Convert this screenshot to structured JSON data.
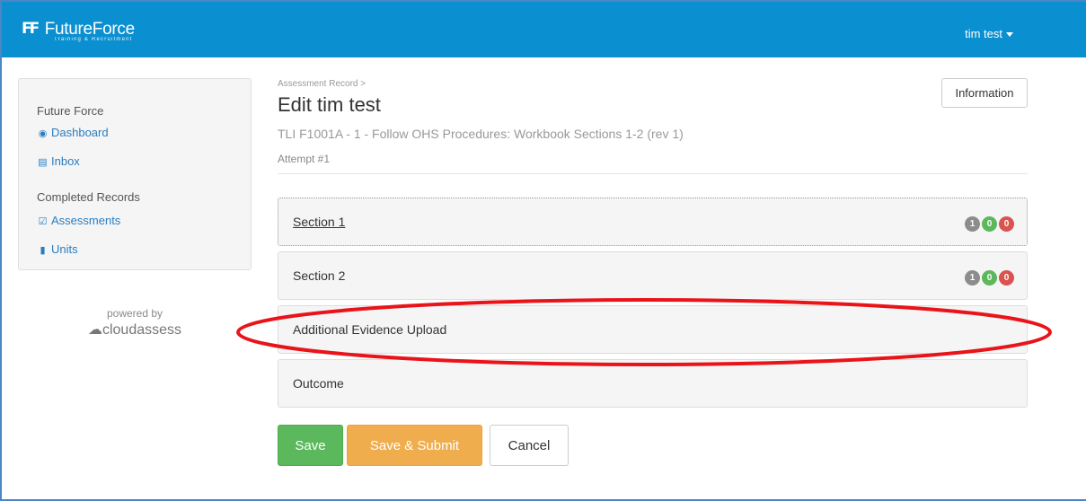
{
  "navbar": {
    "logo_mark": "FF",
    "logo_name": "FutureForce",
    "logo_sub": "Training & Recruitment",
    "user": "tim test"
  },
  "sidebar": {
    "section1_heading": "Future Force",
    "section1_items": [
      {
        "label": "Dashboard",
        "icon": "dashboard-icon"
      },
      {
        "label": "Inbox",
        "icon": "inbox-icon"
      }
    ],
    "section2_heading": "Completed Records",
    "section2_items": [
      {
        "label": "Assessments",
        "icon": "check-square-icon"
      },
      {
        "label": "Units",
        "icon": "book-icon"
      }
    ],
    "powered_by": "powered by",
    "powered_brand": "cloudassess"
  },
  "main": {
    "breadcrumb": "Assessment Record >",
    "title": "Edit tim test",
    "subtitle": "TLI F1001A - 1 - Follow OHS Procedures: Workbook Sections 1-2 (rev 1)",
    "attempt": "Attempt #1",
    "info_button": "Information",
    "sections": [
      {
        "label": "Section 1",
        "active": true,
        "badges": [
          "1",
          "0",
          "0"
        ]
      },
      {
        "label": "Section 2",
        "active": false,
        "badges": [
          "1",
          "0",
          "0"
        ]
      },
      {
        "label": "Additional Evidence Upload",
        "active": false,
        "badges": []
      },
      {
        "label": "Outcome",
        "active": false,
        "badges": []
      }
    ],
    "badge_colors": [
      "#8c8c8c",
      "#5cb85c",
      "#d9534f"
    ]
  },
  "actions": {
    "save": "Save",
    "save_submit": "Save & Submit",
    "cancel": "Cancel"
  },
  "colors": {
    "navbar": "#0a8fd0",
    "link": "#2a7dc0",
    "annotation": "#e8141a"
  }
}
